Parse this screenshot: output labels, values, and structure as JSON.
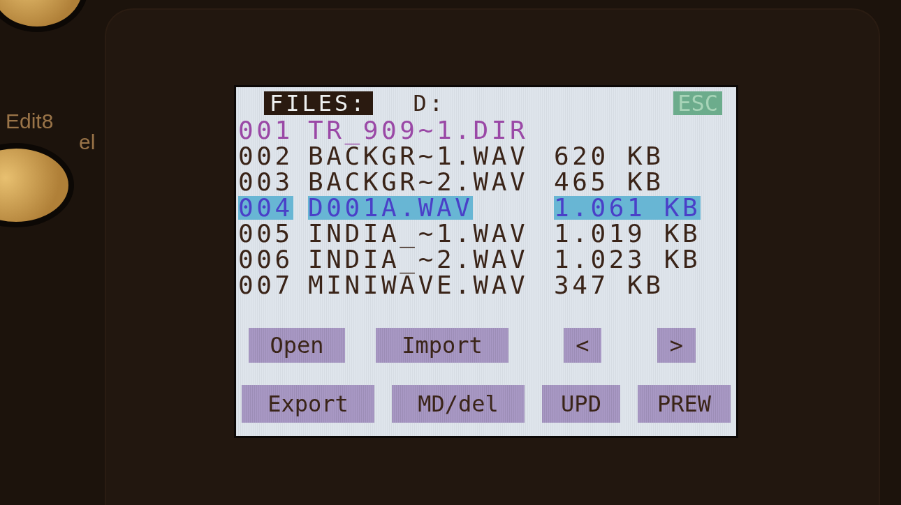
{
  "panel_labels": [
    "Edit8",
    "el"
  ],
  "header": {
    "title": "FILES:",
    "drive": "D:",
    "esc": "ESC"
  },
  "files": [
    {
      "number": "001",
      "name": "TR_909~1.DIR",
      "kind": "dir",
      "selected": false
    },
    {
      "number": "002",
      "name": "BACKGR~1.WAV",
      "size": "620 KB",
      "kind": "file",
      "selected": false
    },
    {
      "number": "003",
      "name": "BACKGR~2.WAV",
      "size": "465 KB",
      "kind": "file",
      "selected": false
    },
    {
      "number": "004",
      "name": "D001A.WAV",
      "size": "1.061 KB",
      "kind": "file",
      "selected": true
    },
    {
      "number": "005",
      "name": "INDIA_~1.WAV",
      "size": "1.019 KB",
      "kind": "file",
      "selected": false
    },
    {
      "number": "006",
      "name": "INDIA_~2.WAV",
      "size": "1.023 KB",
      "kind": "file",
      "selected": false
    },
    {
      "number": "007",
      "name": "MINIWAVE.WAV",
      "size": "347 KB",
      "kind": "file",
      "selected": false
    }
  ],
  "button_rows": [
    {
      "buttons": [
        {
          "label": "Open"
        },
        {
          "label": "Import"
        },
        {
          "label": "<"
        },
        {
          "label": ">"
        }
      ]
    },
    {
      "buttons": [
        {
          "label": "Export"
        },
        {
          "label": "MD/del"
        },
        {
          "label": "UPD"
        },
        {
          "label": "PREW"
        }
      ]
    }
  ]
}
